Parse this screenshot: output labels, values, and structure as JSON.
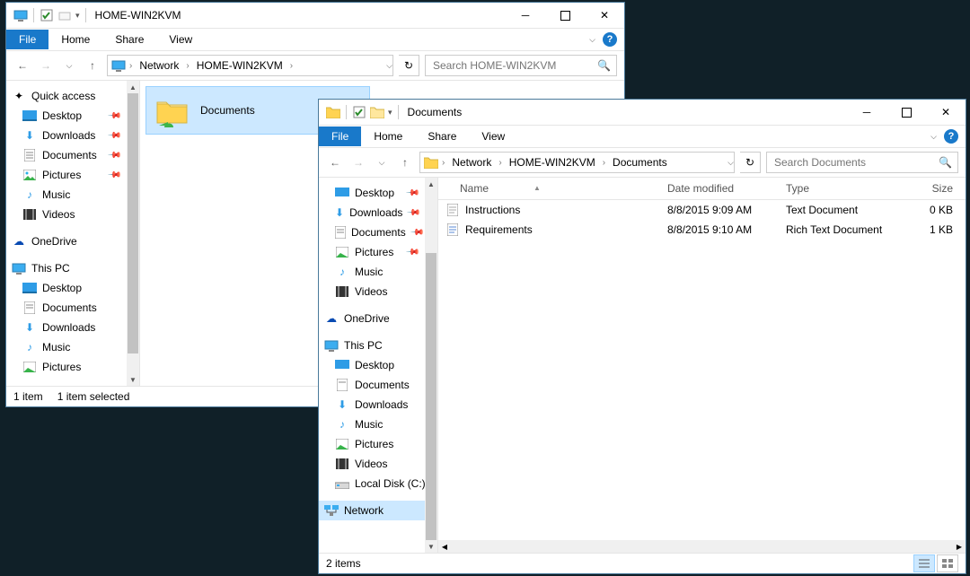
{
  "win1": {
    "title": "HOME-WIN2KVM",
    "ribbon": {
      "file": "File",
      "home": "Home",
      "share": "Share",
      "view": "View"
    },
    "breadcrumbs": [
      "Network",
      "HOME-WIN2KVM"
    ],
    "search_ph": "Search HOME-WIN2KVM",
    "nav": {
      "quick": "Quick access",
      "desktop": "Desktop",
      "downloads": "Downloads",
      "documents": "Documents",
      "pictures": "Pictures",
      "music": "Music",
      "videos": "Videos",
      "onedrive": "OneDrive",
      "thispc": "This PC",
      "pc_desktop": "Desktop",
      "pc_documents": "Documents",
      "pc_downloads": "Downloads",
      "pc_music": "Music",
      "pc_pictures": "Pictures"
    },
    "tiles": {
      "documents": "Documents"
    },
    "status": {
      "count": "1 item",
      "sel": "1 item selected"
    }
  },
  "win2": {
    "title": "Documents",
    "ribbon": {
      "file": "File",
      "home": "Home",
      "share": "Share",
      "view": "View"
    },
    "breadcrumbs": [
      "Network",
      "HOME-WIN2KVM",
      "Documents"
    ],
    "search_ph": "Search Documents",
    "nav": {
      "desktop": "Desktop",
      "downloads": "Downloads",
      "documents": "Documents",
      "pictures": "Pictures",
      "music": "Music",
      "videos": "Videos",
      "onedrive": "OneDrive",
      "thispc": "This PC",
      "pc_desktop": "Desktop",
      "pc_documents": "Documents",
      "pc_downloads": "Downloads",
      "pc_music": "Music",
      "pc_pictures": "Pictures",
      "pc_videos": "Videos",
      "localdisk": "Local Disk (C:)",
      "network": "Network"
    },
    "cols": {
      "name": "Name",
      "date": "Date modified",
      "type": "Type",
      "size": "Size"
    },
    "rows": [
      {
        "name": "Instructions",
        "date": "8/8/2015 9:09 AM",
        "type": "Text Document",
        "size": "0 KB"
      },
      {
        "name": "Requirements",
        "date": "8/8/2015 9:10 AM",
        "type": "Rich Text Document",
        "size": "1 KB"
      }
    ],
    "status": {
      "count": "2 items"
    }
  }
}
